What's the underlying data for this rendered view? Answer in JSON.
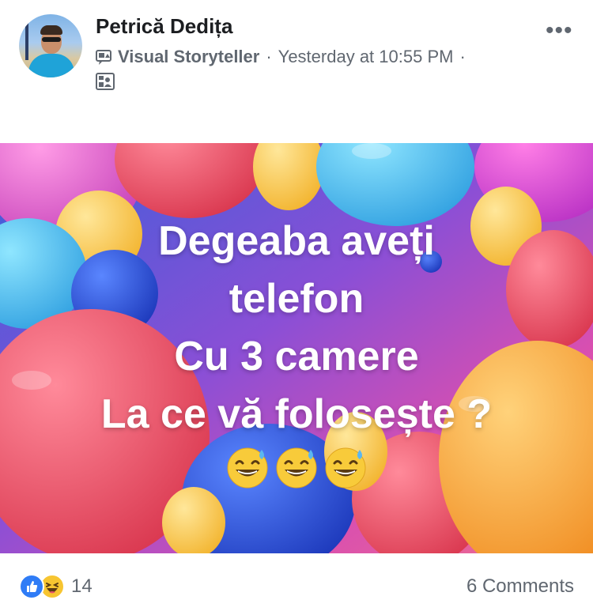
{
  "post": {
    "author": "Petrică Dedița",
    "role": "Visual Storyteller",
    "timestamp": "Yesterday at 10:55 PM",
    "separator": "·",
    "more_label": "•••",
    "audience_icon": "album-icon",
    "badge_icon": "storyteller-badge-icon"
  },
  "image": {
    "text_lines": [
      "Degeaba aveți",
      "telefon",
      "Cu 3 camere",
      "La ce vă folosește ?"
    ],
    "emoji": [
      "😅",
      "😅",
      "😅"
    ]
  },
  "footer": {
    "reactions": [
      "like",
      "haha"
    ],
    "reaction_count": "14",
    "comments_label": "6 Comments"
  },
  "colors": {
    "like": "#2f7cf6",
    "haha": "#f7c531",
    "meta_text": "#606770"
  }
}
